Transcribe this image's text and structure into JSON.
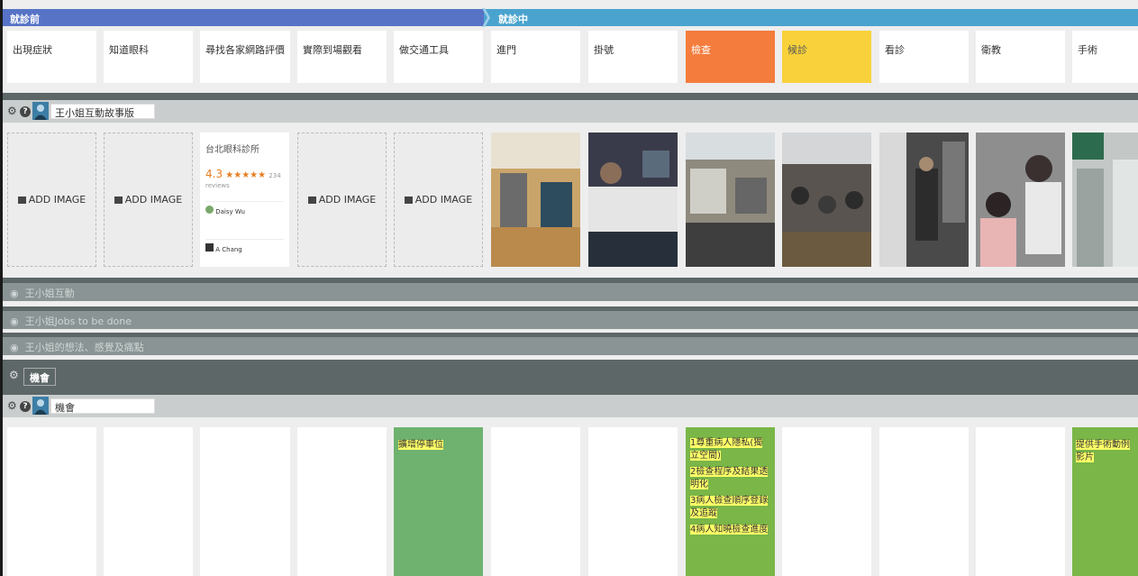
{
  "phases": [
    {
      "label": "就診前",
      "color": "#5673c6"
    },
    {
      "label": "就診中",
      "color": "#4aa3cf"
    }
  ],
  "stages": [
    {
      "label": "出現症狀",
      "color": "#ffffff"
    },
    {
      "label": "知道眼科",
      "color": "#ffffff"
    },
    {
      "label": "尋找各家網路評價",
      "color": "#ffffff"
    },
    {
      "label": "實際到場觀看",
      "color": "#ffffff"
    },
    {
      "label": "做交通工具",
      "color": "#ffffff"
    },
    {
      "label": "進門",
      "color": "#ffffff"
    },
    {
      "label": "掛號",
      "color": "#ffffff"
    },
    {
      "label": "檢查",
      "color": "#f47c3c"
    },
    {
      "label": "候診",
      "color": "#f9d23b"
    },
    {
      "label": "看診",
      "color": "#ffffff"
    },
    {
      "label": "衛教",
      "color": "#ffffff"
    },
    {
      "label": "手術",
      "color": "#ffffff"
    }
  ],
  "persona_row": {
    "name": "王小姐互動故事版",
    "add_image_label": "ADD IMAGE",
    "review_card": {
      "clinic_name": "台北眼科診所",
      "rating": "4.3",
      "stars": "★★★★★",
      "reviews_count": "234 reviews",
      "reviewer1": "Daisy Wu",
      "reviewer2": "A Chang"
    }
  },
  "collapsed_lanes": [
    {
      "label": "王小姐互動"
    },
    {
      "label": "王小姐Jobs to be done"
    },
    {
      "label": "王小姐的想法、感覺及痛點"
    }
  ],
  "opportunity_lane": {
    "header": "機會",
    "name": "機會",
    "notes": {
      "col5": [
        "擴增停車位"
      ],
      "col8": [
        "1尊重病人隱私(獨立空間)",
        "2檢查程序及結果透明化",
        "3病人檢查順序登錄及追蹤",
        "4病人知曉檢查進度"
      ],
      "col12": [
        "提供手術動例影片"
      ]
    }
  },
  "icons": {
    "gear": "gear-icon",
    "info": "info-icon",
    "eye": "eye-icon",
    "avatar": "avatar-icon",
    "image": "image-icon"
  }
}
